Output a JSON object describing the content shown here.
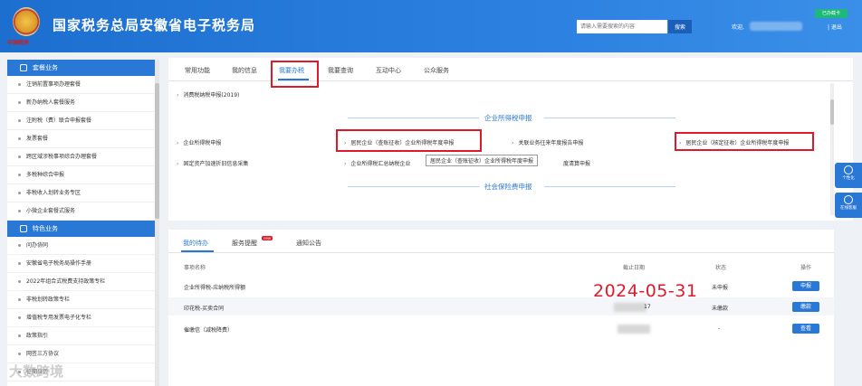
{
  "header": {
    "site_title": "国家税务总局安徽省电子税务局",
    "emblem_text": "中国税务",
    "search_placeholder": "请输入需要搜索的内容",
    "search_button": "搜索",
    "welcome": "欢迎,",
    "logout": "| 退出",
    "badge": "已办截卡"
  },
  "sidebar": {
    "section1_title": "套餐业务",
    "section1_items": [
      "注销前置事项办理套餐",
      "新办纳税人套餐服务",
      "注附税（费）联合申报套餐",
      "发票套餐",
      "跨区域涉税事项综合办理套餐",
      "多税种综合申报",
      "非税收入划转业务专区",
      "小微企业套餐式服务"
    ],
    "section2_title": "特色业务",
    "section2_items": [
      "问办协同",
      "安徽省电子税务局操作手册",
      "2022年组合式税费支持政策专栏",
      "非税划转政策专栏",
      "增值税专用发票电子化专栏",
      "政策指引",
      "网签三方协议",
      "征期日历"
    ]
  },
  "tabs": [
    "常用功能",
    "我的信息",
    "我要办税",
    "我要查询",
    "互动中心",
    "公众服务"
  ],
  "top_panel": {
    "line1": "消费税纳税申报(2019)",
    "section_income_tax": "企业所得税申报",
    "row1": [
      "企业所得税申报",
      "居民企业（查账征收）企业所得税年度申报",
      "关联业务往来年度报告申报",
      "居民企业（核定征收）企业所得税年度申报"
    ],
    "row2": [
      "固定资产加速折旧信息采集",
      "企业所得税汇总纳税企业",
      "度清算申报"
    ],
    "tooltip": "居民企业（查账征收）企业所得税年度申报",
    "section_social": "社会保险费申报"
  },
  "float_buttons": [
    "个性化",
    "在线客服"
  ],
  "bottom_tabs": {
    "tab1": "我的待办",
    "tab2": "服务提醒",
    "new_tag": "new",
    "tab3": "通知公告"
  },
  "table": {
    "headers": [
      "事项名称",
      "截止日期",
      "状态",
      "操作"
    ],
    "rows": [
      {
        "name": "企业所得税-应纳税所得额",
        "deadline": "",
        "status": "未申报",
        "action": "申报"
      },
      {
        "name": "印花税-买卖合同",
        "deadline": "17",
        "status": "未缴款",
        "action": "缴款"
      },
      {
        "name": "催缴信（减税降费）",
        "deadline": "",
        "status": "-",
        "action": "查看"
      }
    ]
  },
  "overlay_date": "2024-05-31",
  "watermark": "大数跨境"
}
